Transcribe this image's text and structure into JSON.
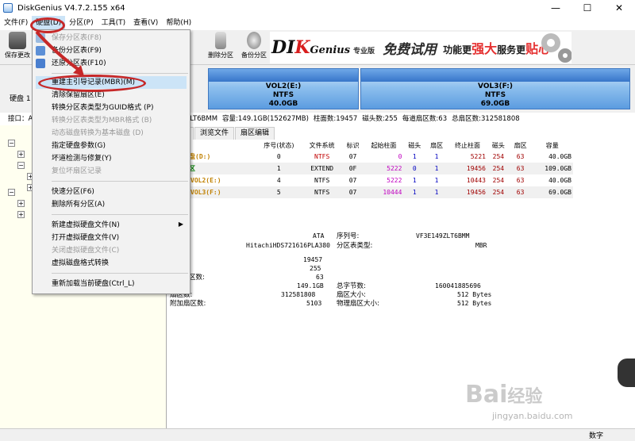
{
  "window": {
    "title": "DiskGenius V4.7.2.155 x64",
    "minimize": "—",
    "maximize": "☐",
    "close": "✕"
  },
  "menu": {
    "items": [
      "文件(F)",
      "硬盘(D)",
      "分区(P)",
      "工具(T)",
      "查看(V)",
      "帮助(H)"
    ]
  },
  "toolbar": {
    "save_label": "保存更改",
    "buttons": [
      "删除分区",
      "备份分区"
    ]
  },
  "banner": {
    "logo_part1": "DI",
    "logo_part2": "K",
    "logo_part3": "Genius",
    "logo_sub": "专业版",
    "slogan": "免费试用",
    "slogan2_a": "功能更",
    "slogan2_b": "强大",
    "slogan2_c": "服务更",
    "slogan2_d": "贴心"
  },
  "disk_bar": {
    "disk_label": "硬盘 1",
    "interface_label": "接口：A",
    "partitions": [
      {
        "name": "VOL2(E:)",
        "fs": "NTFS",
        "size": "40.0GB"
      },
      {
        "name": "VOL3(F:)",
        "fs": "NTFS",
        "size": "69.0GB"
      }
    ]
  },
  "disk_info": {
    "model": "149ZLT6BMM",
    "capacity": "容量:149.1GB(152627MB)",
    "cylinders": "柱面数:19457",
    "heads": "磁头数:255",
    "sectors": "每道扇区数:63",
    "total_sectors": "总扇区数:312581808"
  },
  "tabs": [
    "参数",
    "浏览文件",
    "扇区编辑"
  ],
  "table": {
    "headers": [
      "",
      "序号(状态)",
      "文件系统",
      "标识",
      "起始柱面",
      "磁头",
      "扇区",
      "终止柱面",
      "磁头",
      "扇区",
      "容量"
    ],
    "rows": [
      {
        "name": "本地磁盘(D:)",
        "idx": "0",
        "fs": "NTFS",
        "id": "07",
        "sc": "0",
        "sh": "1",
        "ss": "1",
        "ec": "5221",
        "eh": "254",
        "es": "63",
        "cap": "40.0GB"
      },
      {
        "name": "扩展分区",
        "idx": "1",
        "fs": "EXTEND",
        "id": "0F",
        "sc": "5222",
        "sh": "0",
        "ss": "1",
        "ec": "19456",
        "eh": "254",
        "es": "63",
        "cap": "109.0GB"
      },
      {
        "name": "VOL2(E:)",
        "idx": "4",
        "fs": "NTFS",
        "id": "07",
        "sc": "5222",
        "sh": "1",
        "ss": "1",
        "ec": "10443",
        "eh": "254",
        "es": "63",
        "cap": "40.0GB"
      },
      {
        "name": "VOL3(F:)",
        "idx": "5",
        "fs": "NTFS",
        "id": "07",
        "sc": "10444",
        "sh": "1",
        "ss": "1",
        "ec": "19456",
        "eh": "254",
        "es": "63",
        "cap": "69.0GB"
      }
    ]
  },
  "details": {
    "type_label": "型:",
    "type_val": "ATA",
    "model_val": "HitachiHDS721616PLA380",
    "serial_label": "序列号:",
    "serial_val": "VF3E149ZLT6BMM",
    "ptype_label": "分区表类型:",
    "ptype_val": "MBR",
    "cyl_label": ":",
    "cyl_val": "19457",
    "heads_label": ":",
    "heads_val": "255",
    "spt_label": "区数:",
    "spt_val": "63",
    "cap_label": ":",
    "cap_val": "149.1GB",
    "total_bytes_label": "总字节数:",
    "total_bytes_val": "160041885696",
    "total_sec_label": "扇区数:",
    "total_sec_val": "312581808",
    "sec_size_label": "扇区大小:",
    "sec_size_val": "512 Bytes",
    "extra_label": "附加扇区数:",
    "extra_val": "5103",
    "phys_label": "物理扇区大小:",
    "phys_val": "512 Bytes"
  },
  "dropdown": {
    "items": [
      {
        "label": "保存分区表(F8)",
        "disabled": true
      },
      {
        "label": "备份分区表(F9)",
        "disabled": false
      },
      {
        "label": "还原分区表(F10)",
        "disabled": false
      },
      {
        "label": "重建主引导记录(MBR)(M)",
        "disabled": false
      },
      {
        "label": "清除保留扇区(E)",
        "disabled": false
      },
      {
        "label": "转换分区表类型为GUID格式 (P)",
        "disabled": false
      },
      {
        "label": "转换分区表类型为MBR格式 (B)",
        "disabled": true
      },
      {
        "label": "动态磁盘转换为基本磁盘 (D)",
        "disabled": true
      },
      {
        "label": "指定硬盘参数(G)",
        "disabled": false
      },
      {
        "label": "坏道检测与修复(Y)",
        "disabled": false
      },
      {
        "label": "复位坏扇区记录",
        "disabled": true
      },
      {
        "label": "快速分区(F6)",
        "disabled": false
      },
      {
        "label": "删除所有分区(A)",
        "disabled": false
      },
      {
        "label": "新建虚拟硬盘文件(N)",
        "disabled": false
      },
      {
        "label": "打开虚拟硬盘文件(V)",
        "disabled": false
      },
      {
        "label": "关闭虚拟硬盘文件(C)",
        "disabled": true
      },
      {
        "label": "虚拟磁盘格式转换",
        "disabled": false
      },
      {
        "label": "重新加载当前硬盘(Ctrl_L)",
        "disabled": false
      }
    ]
  },
  "status": {
    "mode": "数字"
  },
  "watermark": {
    "main": "Bai",
    "brand": "经验",
    "url": "jingyan.baidu.com"
  },
  "colors": {
    "accent": "#cce4f7",
    "partition": "#8ec0ee",
    "annotation": "#c62828"
  }
}
